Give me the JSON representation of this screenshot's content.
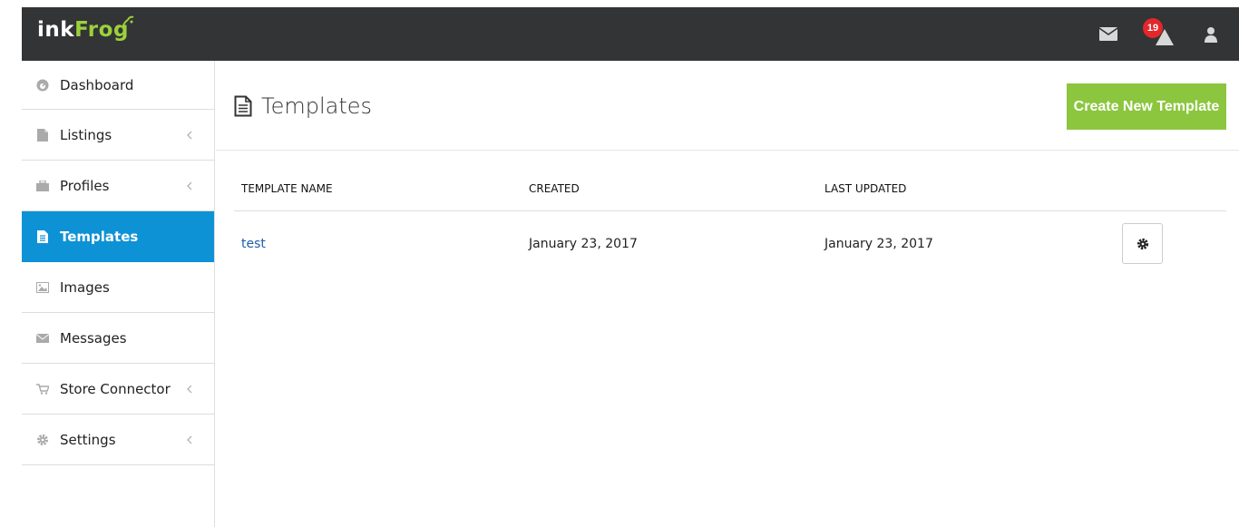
{
  "app": {
    "logo_ink": "ink",
    "logo_frog": "Frog",
    "notification_count": "19"
  },
  "sidebar": {
    "items": [
      {
        "label": "Dashboard",
        "icon": "dashboard-icon",
        "has_submenu": false,
        "active": false
      },
      {
        "label": "Listings",
        "icon": "file-icon",
        "has_submenu": true,
        "active": false
      },
      {
        "label": "Profiles",
        "icon": "briefcase-icon",
        "has_submenu": true,
        "active": false
      },
      {
        "label": "Templates",
        "icon": "file-text-icon",
        "has_submenu": false,
        "active": true
      },
      {
        "label": "Images",
        "icon": "image-icon",
        "has_submenu": false,
        "active": false
      },
      {
        "label": "Messages",
        "icon": "envelope-icon",
        "has_submenu": false,
        "active": false
      },
      {
        "label": "Store Connector",
        "icon": "cart-icon",
        "has_submenu": true,
        "active": false
      },
      {
        "label": "Settings",
        "icon": "gear-icon",
        "has_submenu": true,
        "active": false
      }
    ]
  },
  "page": {
    "title": "Templates",
    "create_button": "Create New Template"
  },
  "table": {
    "columns": [
      "TEMPLATE NAME",
      "CREATED",
      "LAST UPDATED"
    ],
    "rows": [
      {
        "name": "test",
        "created": "January 23, 2017",
        "updated": "January 23, 2017"
      }
    ]
  },
  "colors": {
    "topbar": "#333436",
    "accent_blue": "#0e92d6",
    "create_green": "#8cc63f",
    "badge_red": "#e3272a",
    "link_blue": "#1f5ea8"
  }
}
